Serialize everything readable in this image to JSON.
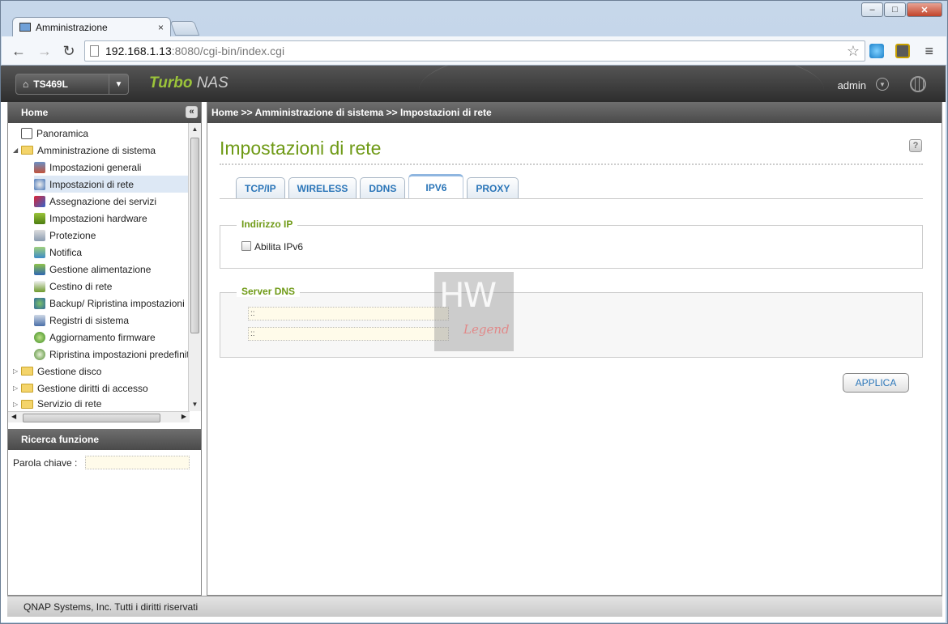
{
  "browser": {
    "tab_title": "Amministrazione",
    "tab_close": "×",
    "url_host": "192.168.1.13",
    "url_rest": ":8080/cgi-bin/index.cgi",
    "back": "←",
    "forward": "→",
    "reload": "↻",
    "star": "☆",
    "menu": "≡",
    "min": "–",
    "max": "□",
    "close": "✕"
  },
  "header": {
    "device": "TS469L",
    "brand_turbo": "Turbo",
    "brand_nas": " NAS",
    "user": "admin"
  },
  "sidebar": {
    "title": "Home",
    "collapse": "«",
    "items": [
      {
        "label": "Panoramica"
      },
      {
        "label": "Amministrazione di sistema"
      },
      {
        "label": "Impostazioni generali"
      },
      {
        "label": "Impostazioni di rete"
      },
      {
        "label": "Assegnazione dei servizi"
      },
      {
        "label": "Impostazioni hardware"
      },
      {
        "label": "Protezione"
      },
      {
        "label": "Notifica"
      },
      {
        "label": "Gestione alimentazione"
      },
      {
        "label": "Cestino di rete"
      },
      {
        "label": "Backup/ Ripristina impostazioni"
      },
      {
        "label": "Registri di sistema"
      },
      {
        "label": "Aggiornamento firmware"
      },
      {
        "label": "Ripristina impostazioni predefinite"
      },
      {
        "label": "Gestione disco"
      },
      {
        "label": "Gestione diritti di accesso"
      },
      {
        "label": "Servizio di rete"
      }
    ],
    "search_title": "Ricerca funzione",
    "keyword_label": "Parola chiave :"
  },
  "main": {
    "breadcrumb": "Home >> Amministrazione di sistema >> Impostazioni di rete",
    "title": "Impostazioni di rete",
    "help": "?",
    "tabs": [
      {
        "label": "TCP/IP"
      },
      {
        "label": "WIRELESS"
      },
      {
        "label": "DDNS"
      },
      {
        "label": "IPV6"
      },
      {
        "label": "PROXY"
      }
    ],
    "ip_section": {
      "legend": "Indirizzo IP",
      "checkbox_label": "Abilita IPv6"
    },
    "dns_section": {
      "legend": "Server DNS",
      "dns1": "::",
      "dns2": "::"
    },
    "apply": "APPLICA"
  },
  "watermark": {
    "hw": "HW",
    "legend": "Legend"
  },
  "footer": {
    "text": "QNAP Systems, Inc. Tutti i diritti riservati"
  }
}
